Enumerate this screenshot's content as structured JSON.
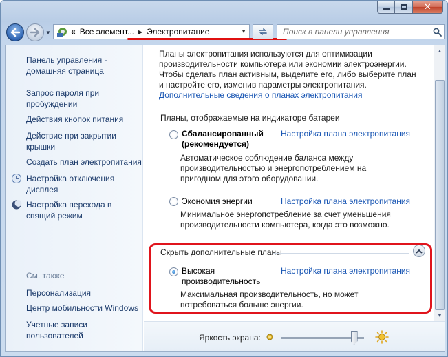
{
  "window": {
    "controls": {
      "minimize": "minimize",
      "maximize": "maximize",
      "close": "close"
    }
  },
  "nav": {
    "breadcrumb_prefix": "«",
    "breadcrumb_1": "Все элемент...",
    "breadcrumb_2": "Электропитание",
    "search_placeholder": "Поиск в панели управления"
  },
  "sidebar": {
    "home": "Панель управления - домашняя страница",
    "items": [
      "Запрос пароля при пробуждении",
      "Действия кнопок питания",
      "Действие при закрытии крышки",
      "Создать план электропитания",
      "Настройка отключения дисплея",
      "Настройка перехода в спящий режим"
    ],
    "see_also_title": "См. также",
    "see_also": [
      "Персонализация",
      "Центр мобильности Windows",
      "Учетные записи пользователей"
    ]
  },
  "main": {
    "intro": "Планы электропитания используются для оптимизации производительности компьютера или экономии электроэнергии. Чтобы сделать план активным, выделите его, либо выберите план и настройте его, изменив параметры электропитания.",
    "intro_link": "Дополнительные сведения о планах электропитания",
    "battery_group_title": "Планы, отображаемые на индикаторе батареи",
    "plans": [
      {
        "name": "Сбалансированный (рекомендуется)",
        "link": "Настройка плана электропитания",
        "desc": "Автоматическое соблюдение баланса между производительностью и энергопотреблением на пригодном для этого оборудовании.",
        "selected": false
      },
      {
        "name": "Экономия энергии",
        "link": "Настройка плана электропитания",
        "desc": "Минимальное энергопотребление за счет уменьшения производительности компьютера, когда это возможно.",
        "selected": false
      }
    ],
    "hidden_group_title": "Скрыть дополнительные планы",
    "hidden_plans": [
      {
        "name": "Высокая производительность",
        "link": "Настройка плана электропитания",
        "desc": "Максимальная производительность, но может потребоваться больше энергии.",
        "selected": true
      }
    ],
    "brightness_label": "Яркость экрана:",
    "brightness_level": 0.88
  },
  "colors": {
    "link": "#1a57b4",
    "sidebar_link": "#1c3b6b",
    "highlight_red": "#e0141c",
    "window_frame": "#b9cde6"
  }
}
